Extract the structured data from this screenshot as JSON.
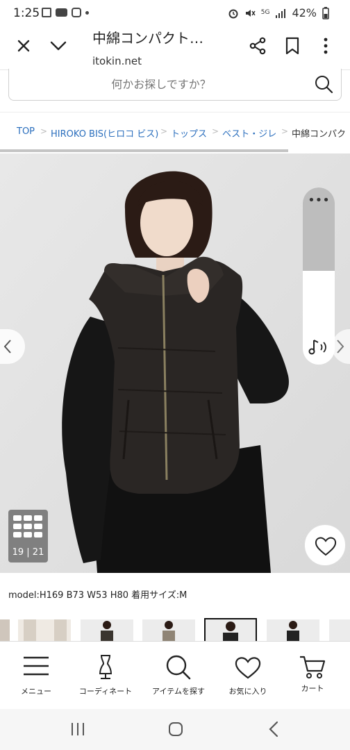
{
  "status_bar": {
    "time": "1:25",
    "network": "5G",
    "battery": "42%"
  },
  "browser": {
    "title": "中綿コンパクト…",
    "domain": "itokin.net",
    "icons": {
      "close": "close-icon",
      "collapse": "chevron-down-icon",
      "share": "share-icon",
      "bookmark": "bookmark-icon",
      "more": "more-vertical-icon"
    }
  },
  "search": {
    "placeholder": "何かお探しですか？"
  },
  "breadcrumb": [
    {
      "label": "TOP"
    },
    {
      "label": "HIROKO BIS(ヒロコ ビス)"
    },
    {
      "label": "トップス"
    },
    {
      "label": "ベスト・ジレ"
    },
    {
      "label": "中綿コンパク"
    }
  ],
  "gallery": {
    "counter": "19 | 21"
  },
  "product": {
    "model_info": "model:H169 B73 W53 H80 着用サイズ:M"
  },
  "bottom_nav": [
    {
      "label": "メニュー",
      "icon": "menu-icon"
    },
    {
      "label": "コーディネート",
      "icon": "mannequin-icon"
    },
    {
      "label": "アイテムを探す",
      "icon": "search-icon"
    },
    {
      "label": "お気に入り",
      "icon": "heart-icon"
    },
    {
      "label": "カート",
      "icon": "cart-icon"
    }
  ],
  "colors": {
    "link": "#2a6ebd",
    "photo_bg": "#e3e3e3",
    "garment": "#2a2624"
  }
}
